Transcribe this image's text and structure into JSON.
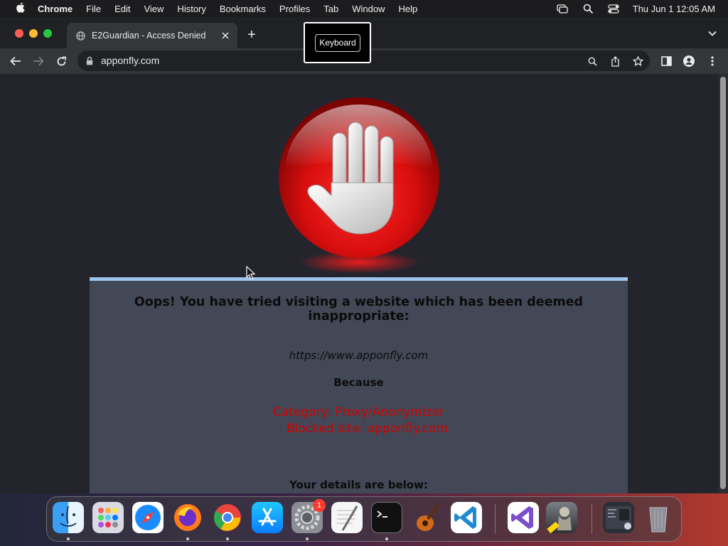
{
  "menubar": {
    "app_name": "Chrome",
    "menus": [
      "File",
      "Edit",
      "View",
      "History",
      "Bookmarks",
      "Profiles",
      "Tab",
      "Window",
      "Help"
    ],
    "clock": "Thu Jun 1  12:05 AM"
  },
  "browser": {
    "tab_title": "E2Guardian - Access Denied",
    "new_tab_label": "+",
    "url": "apponfly.com"
  },
  "tooltip": {
    "label": "Keyboard"
  },
  "page": {
    "heading": "Oops! You have tried visiting a website which has been deemed inappropriate:",
    "blocked_url": "https://www.apponfly.com",
    "because_label": "Because",
    "reason_category": "Category: Proxy/Anonymizer",
    "reason_site": "Blocked site: apponfly.com",
    "details_label": "Your details are below:"
  },
  "dock": {
    "apps": [
      "Finder",
      "Launchpad",
      "Safari",
      "Firefox",
      "Google Chrome",
      "App Store",
      "System Settings",
      "TextEdit",
      "Terminal",
      "GarageBand",
      "Visual Studio Code",
      "Visual Studio",
      "Chess",
      "Screenshot",
      "Trash"
    ],
    "settings_badge": "1"
  },
  "colors": {
    "reason_text": "#d40000",
    "panel_accent": "#9ec6ee",
    "panel_bg": "#434856",
    "page_bg": "#23242c"
  }
}
